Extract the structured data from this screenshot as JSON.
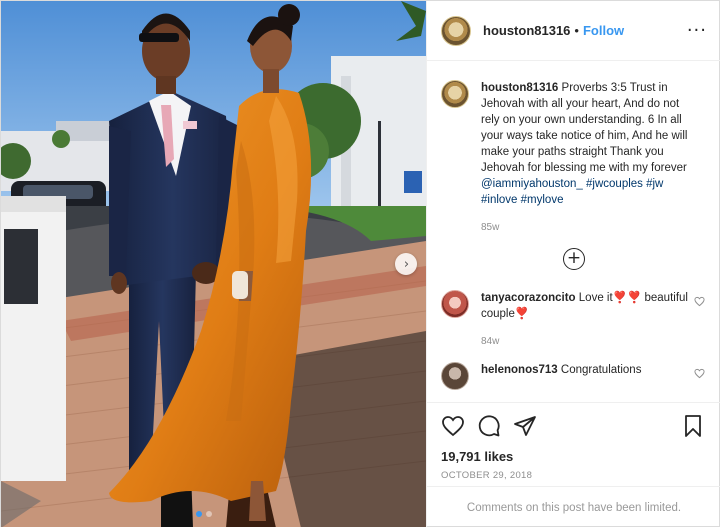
{
  "post": {
    "username": "houston81316",
    "separator": "•",
    "follow_label": "Follow",
    "more_icon": "more-options-icon",
    "carousel_next_icon": "chevron-right-icon"
  },
  "caption": {
    "username": "houston81316",
    "text": " Proverbs 3:5 Trust in Jehovah with all your heart, And do not rely on your own understanding. 6 In all your ways take notice of him, And he will make your paths straight Thank you Jehovah for blessing me with my forever ",
    "mention": "@iammiyahouston_",
    "hashtags": "#jwcouples #jw #inlove #mylove",
    "time": "85w"
  },
  "load_more_icon": "plus-circle-icon",
  "comments": [
    {
      "username": "tanyacorazoncito",
      "text": " Love it❣️❣️ beautiful couple❣️",
      "time": "84w"
    },
    {
      "username": "helenonos713",
      "text": " Congratulations",
      "time": ""
    }
  ],
  "actions": {
    "likes": "19,791 likes",
    "date": "OCTOBER 29, 2018",
    "comments_limited": "Comments on this post have been limited."
  },
  "colors": {
    "link": "#3897f0",
    "mention": "#00376b",
    "dress": "#e0861c",
    "suit": "#1f2d52",
    "sky": "#5e9ad8"
  }
}
